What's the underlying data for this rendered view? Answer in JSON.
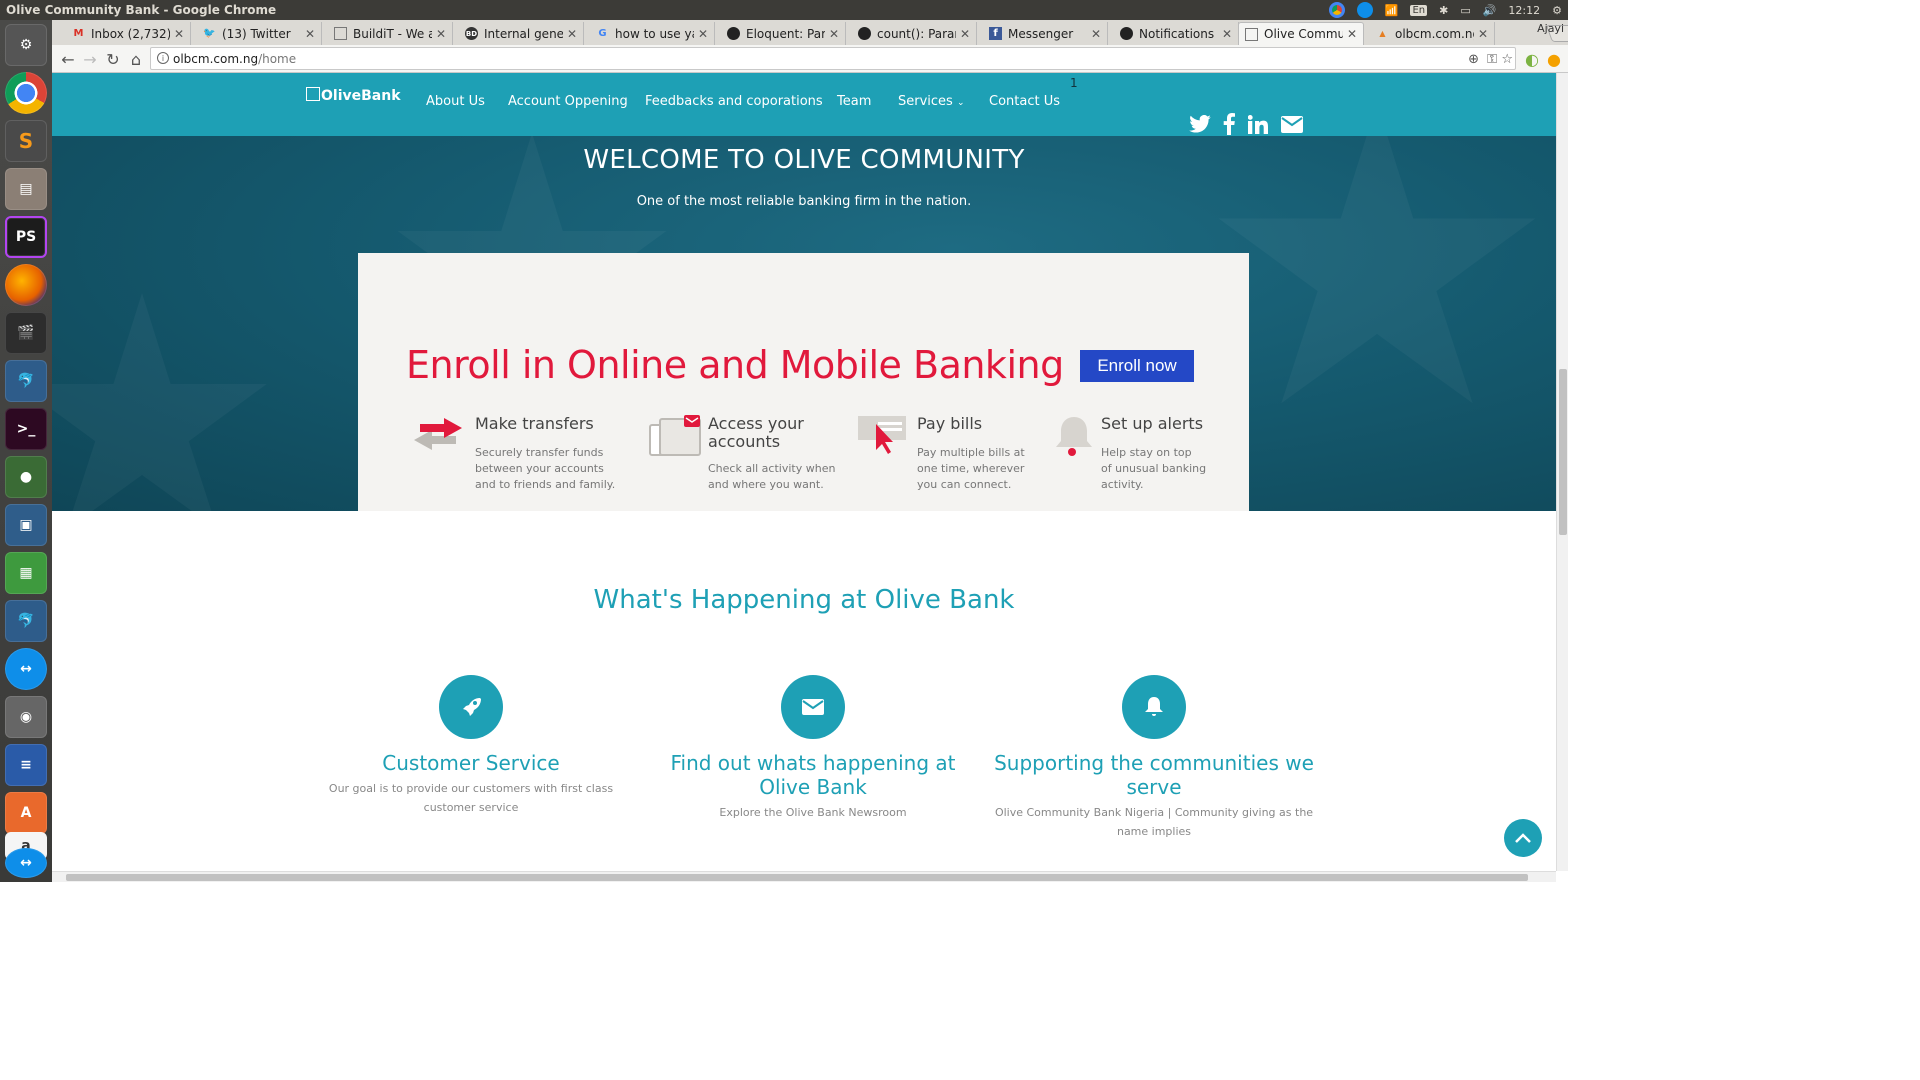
{
  "os": {
    "window_title": "Olive Community Bank - Google Chrome",
    "tray": {
      "keyboard": "En",
      "clock": "12:12"
    }
  },
  "launcher": {
    "apps": [
      "system-settings",
      "chrome",
      "sublime-text",
      "files",
      "phpstorm",
      "firefox",
      "video-editor",
      "mysql-workbench",
      "terminal",
      "robo3t",
      "virtualbox",
      "spreadsheet",
      "mysql-workbench-2",
      "teamviewer",
      "speaker",
      "writer",
      "software-center",
      "amazon",
      "teamviewer-2"
    ]
  },
  "browser": {
    "tabs": [
      {
        "label": "Inbox (2,732) -",
        "icon": "gmail-icon"
      },
      {
        "label": "(13) Twitter",
        "icon": "twitter-icon"
      },
      {
        "label": "BuildiT - We ar",
        "icon": "page-icon"
      },
      {
        "label": "Internal gener",
        "icon": "bd-icon"
      },
      {
        "label": "how to use ya",
        "icon": "google-icon"
      },
      {
        "label": "Eloquent: Para",
        "icon": "github-icon"
      },
      {
        "label": "count(): Param",
        "icon": "github-icon"
      },
      {
        "label": "Messenger",
        "icon": "facebook-icon"
      },
      {
        "label": "Notifications",
        "icon": "github-icon"
      },
      {
        "label": "Olive Commun",
        "icon": "page-icon",
        "active": true
      },
      {
        "label": "olbcm.com.ng",
        "icon": "php-icon"
      }
    ],
    "profile": "Ajayi",
    "url": {
      "host": "olbcm.com.ng",
      "path": "/home"
    }
  },
  "site": {
    "logo": "OliveBank",
    "nav": [
      "About Us",
      "Account Oppening",
      "Feedbacks and coporations",
      "Team",
      "Services",
      "Contact Us"
    ],
    "nav_badge": "1",
    "hero": {
      "title": "WELCOME TO OLIVE COMMUNITY",
      "subtitle": "One of the most reliable banking firm in the nation."
    },
    "promo": {
      "title": "Enroll in Online and Mobile Banking",
      "button": "Enroll now",
      "features": [
        {
          "title": "Make transfers",
          "desc": [
            "Securely transfer funds",
            "between your accounts",
            "and to friends and family."
          ]
        },
        {
          "title": "Access your accounts",
          "title_lines": [
            "Access your",
            "accounts"
          ],
          "desc": [
            "Check all activity when",
            "and where you want."
          ]
        },
        {
          "title": "Pay bills",
          "desc": [
            "Pay multiple bills at",
            "one time, wherever",
            "you can connect."
          ]
        },
        {
          "title": "Set up alerts",
          "desc": [
            "Help stay on top",
            "of unusual banking",
            "activity."
          ]
        }
      ]
    },
    "section_title": "What's Happening at Olive Bank",
    "columns": [
      {
        "icon": "rocket-icon",
        "title": "Customer Service",
        "desc": "Our goal is to provide our customers with first class customer service"
      },
      {
        "icon": "envelope-icon",
        "title": "Find out whats happening at Olive Bank",
        "desc": "Explore the Olive Bank Newsroom"
      },
      {
        "icon": "bell-icon",
        "title": "Supporting the communities we serve",
        "desc": "Olive Community Bank Nigeria | Community giving as the name implies"
      }
    ]
  },
  "colors": {
    "accent": "#1ea0b5",
    "promo_red": "#e1193c",
    "button_blue": "#2448c6",
    "hero_dark": "#155a6f"
  }
}
